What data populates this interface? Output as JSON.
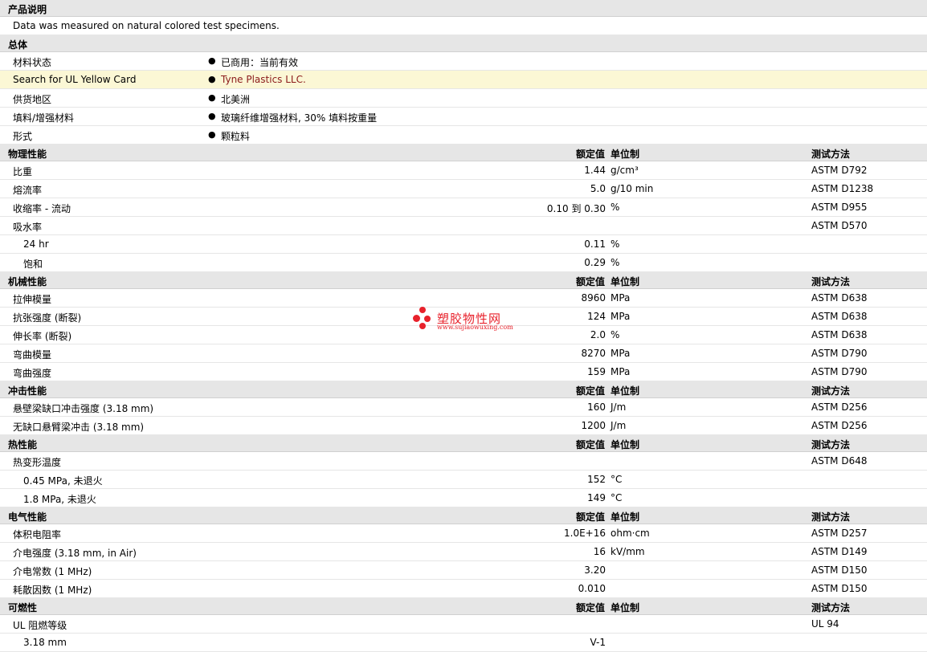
{
  "sections": {
    "desc": {
      "title": "产品说明",
      "note": "Data was measured on natural colored test specimens."
    },
    "general": {
      "title": "总体",
      "rows": [
        {
          "label": "材料状态",
          "value": "已商用：当前有效"
        },
        {
          "label": "Search for UL Yellow Card",
          "value": "Tyne Plastics LLC."
        },
        {
          "label": "供货地区",
          "value": "北美洲"
        },
        {
          "label": "填料/增强材料",
          "value": "玻璃纤维增强材料, 30% 填料按重量"
        },
        {
          "label": "形式",
          "value": "颗粒料"
        }
      ]
    },
    "headers": {
      "nominal": "额定值",
      "unit": "单位制",
      "method": "测试方法"
    },
    "physical": {
      "title": "物理性能",
      "rows": [
        {
          "label": "比重",
          "value": "1.44",
          "unit": "g/cm³",
          "method": "ASTM D792"
        },
        {
          "label": "熔流率",
          "value": "5.0",
          "unit": "g/10 min",
          "method": "ASTM D1238"
        },
        {
          "label": "收缩率 - 流动",
          "value": "0.10 到 0.30",
          "unit": "%",
          "method": "ASTM D955"
        },
        {
          "label": "吸水率",
          "value": "",
          "unit": "",
          "method": "ASTM D570"
        },
        {
          "label": "24 hr",
          "value": "0.11",
          "unit": "%",
          "method": ""
        },
        {
          "label": "饱和",
          "value": "0.29",
          "unit": "%",
          "method": ""
        }
      ]
    },
    "mechanical": {
      "title": "机械性能",
      "rows": [
        {
          "label": "拉伸模量",
          "value": "8960",
          "unit": "MPa",
          "method": "ASTM D638"
        },
        {
          "label": "抗张强度 (断裂)",
          "value": "124",
          "unit": "MPa",
          "method": "ASTM D638"
        },
        {
          "label": "伸长率 (断裂)",
          "value": "2.0",
          "unit": "%",
          "method": "ASTM D638"
        },
        {
          "label": "弯曲模量",
          "value": "8270",
          "unit": "MPa",
          "method": "ASTM D790"
        },
        {
          "label": "弯曲强度",
          "value": "159",
          "unit": "MPa",
          "method": "ASTM D790"
        }
      ]
    },
    "impact": {
      "title": "冲击性能",
      "rows": [
        {
          "label": "悬壁梁缺口冲击强度 (3.18 mm)",
          "value": "160",
          "unit": "J/m",
          "method": "ASTM D256"
        },
        {
          "label": "无缺口悬臂梁冲击 (3.18 mm)",
          "value": "1200",
          "unit": "J/m",
          "method": "ASTM D256"
        }
      ]
    },
    "thermal": {
      "title": "热性能",
      "rows": [
        {
          "label": "热变形温度",
          "value": "",
          "unit": "",
          "method": "ASTM D648"
        },
        {
          "label": "0.45 MPa, 未退火",
          "value": "152",
          "unit": "°C",
          "method": ""
        },
        {
          "label": "1.8 MPa, 未退火",
          "value": "149",
          "unit": "°C",
          "method": ""
        }
      ]
    },
    "electrical": {
      "title": "电气性能",
      "rows": [
        {
          "label": "体积电阻率",
          "value": "1.0E+16",
          "unit": "ohm·cm",
          "method": "ASTM D257"
        },
        {
          "label": "介电强度 (3.18 mm, in Air)",
          "value": "16",
          "unit": "kV/mm",
          "method": "ASTM D149"
        },
        {
          "label": "介电常数 (1 MHz)",
          "value": "3.20",
          "unit": "",
          "method": "ASTM D150"
        },
        {
          "label": "耗散因数 (1 MHz)",
          "value": "0.010",
          "unit": "",
          "method": "ASTM D150"
        }
      ]
    },
    "flammability": {
      "title": "可燃性",
      "rows": [
        {
          "label": "UL 阻燃等级",
          "value": "",
          "unit": "",
          "method": "UL 94"
        },
        {
          "label": "3.18 mm",
          "value": "V-1",
          "unit": "",
          "method": ""
        }
      ]
    }
  },
  "watermark": {
    "name": "塑胶物性网",
    "url": "www.sujiaowuxing.com"
  },
  "colors": {
    "header_bg": "#e6e6e6",
    "highlight_bg": "#fbf7d5",
    "link": "#8b1a1a",
    "watermark": "#e8212b"
  }
}
